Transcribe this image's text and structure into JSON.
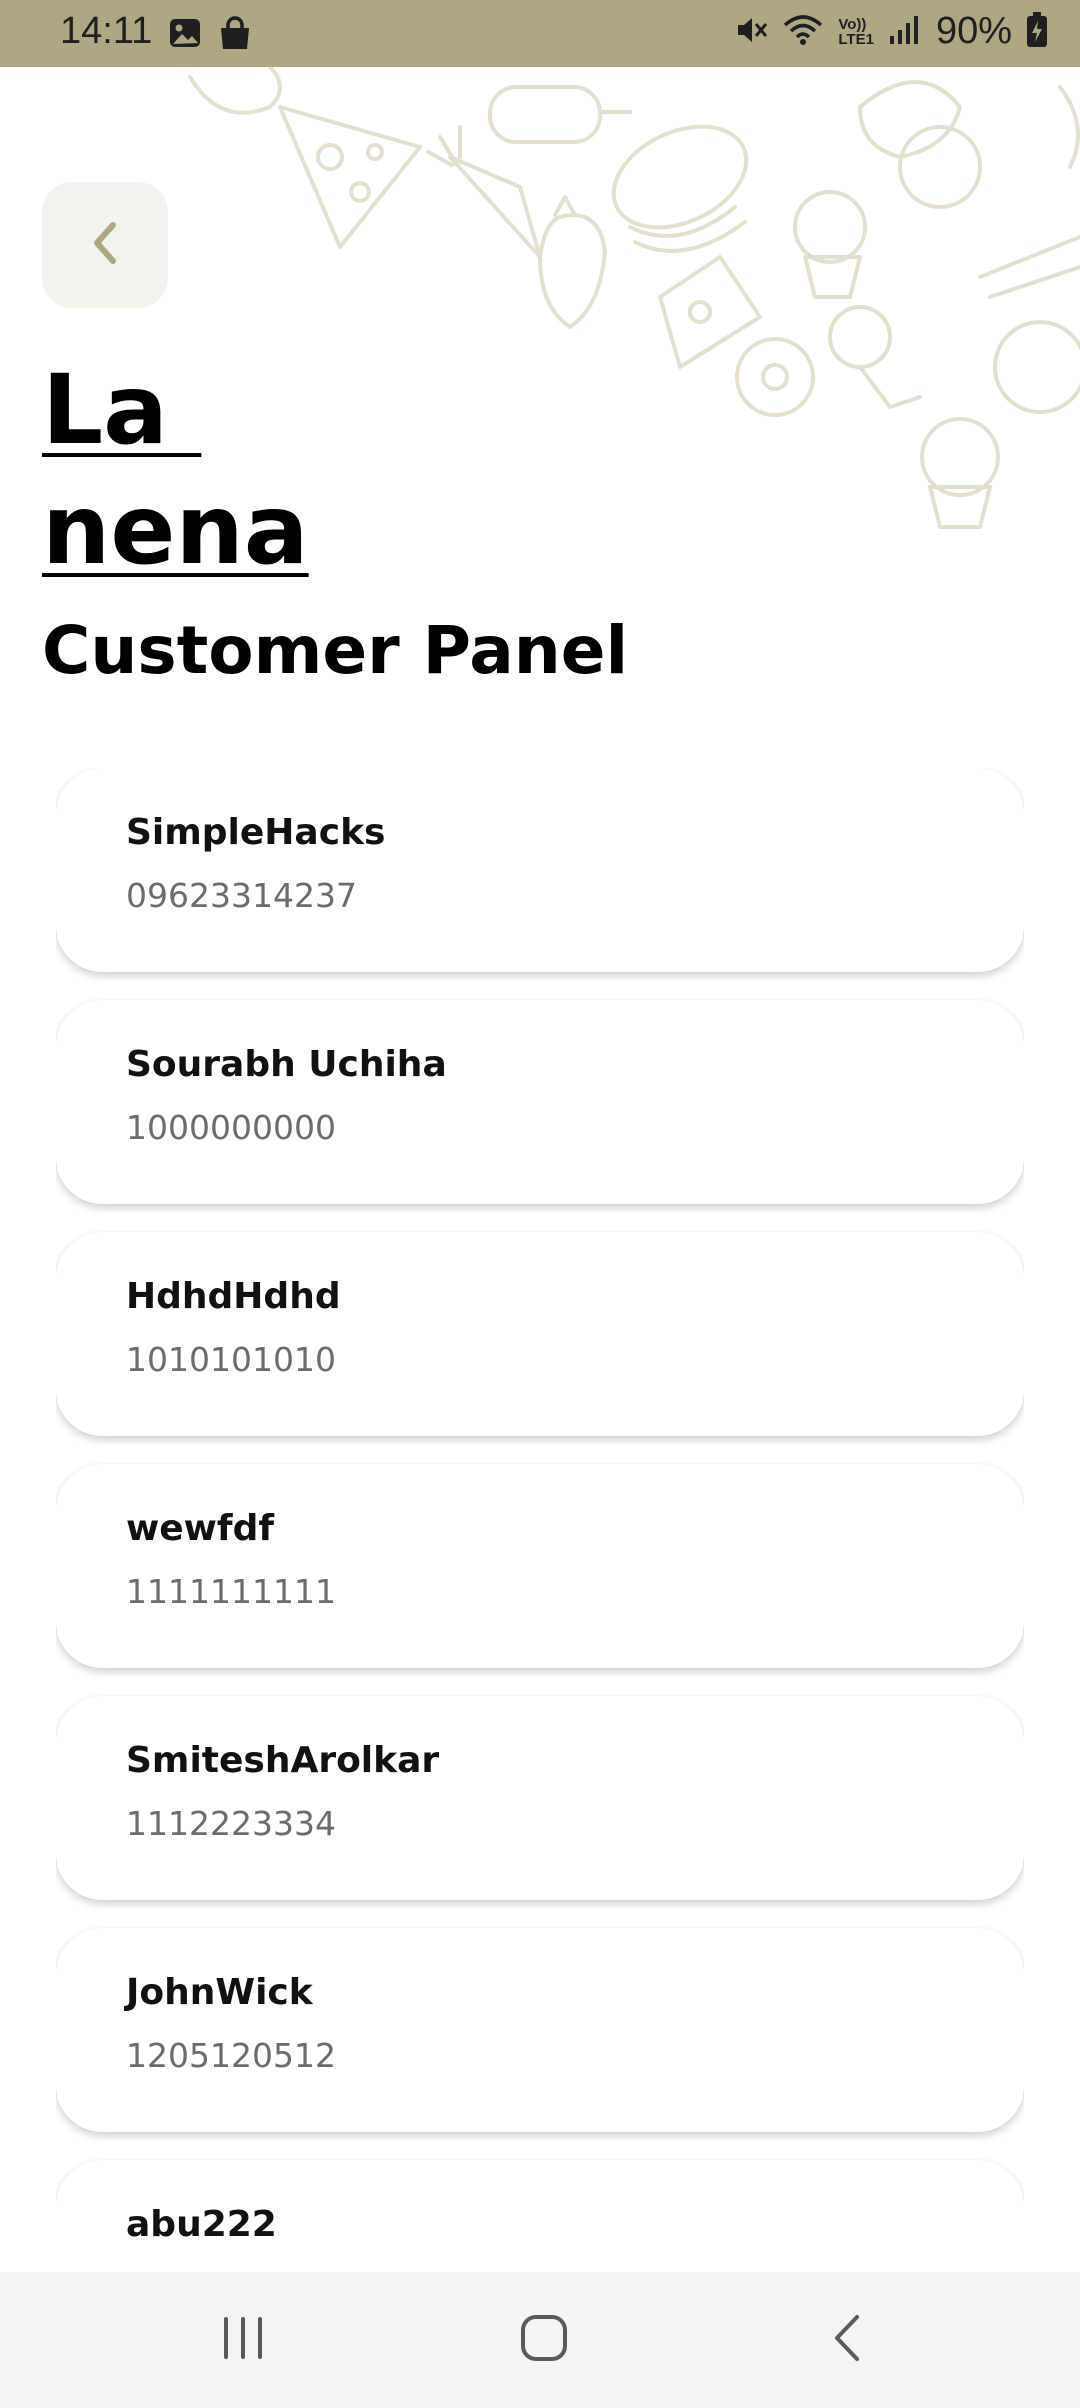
{
  "status_bar": {
    "time": "14:11",
    "battery": "90%",
    "icons": [
      "image-icon",
      "shopping-bag-icon",
      "mute-icon",
      "wifi-icon",
      "volte-icon",
      "signal-icon",
      "battery-charging-icon"
    ],
    "volte_label_top": "Vo))",
    "volte_label_bottom": "LTE1",
    "background": "#ada783"
  },
  "header": {
    "back_icon": "chevron-left-icon",
    "brand_line_1": "La ",
    "brand_line_2": "nena",
    "title": "Customer Panel"
  },
  "customers": [
    {
      "name": "SimpleHacks",
      "phone": "09623314237"
    },
    {
      "name": "Sourabh Uchiha",
      "phone": "1000000000"
    },
    {
      "name": "HdhdHdhd",
      "phone": "1010101010"
    },
    {
      "name": "wewfdf",
      "phone": "1111111111"
    },
    {
      "name": "SmiteshArolkar",
      "phone": "1112223334"
    },
    {
      "name": "JohnWick",
      "phone": "1205120512"
    },
    {
      "name": "abu222",
      "phone": ""
    }
  ],
  "nav": {
    "icons": [
      "recents-icon",
      "home-icon",
      "back-icon"
    ]
  },
  "colors": {
    "accent": "#ada783",
    "back_button_bg": "#f4f2ec",
    "doodle_stroke": "#e2dfcf"
  }
}
